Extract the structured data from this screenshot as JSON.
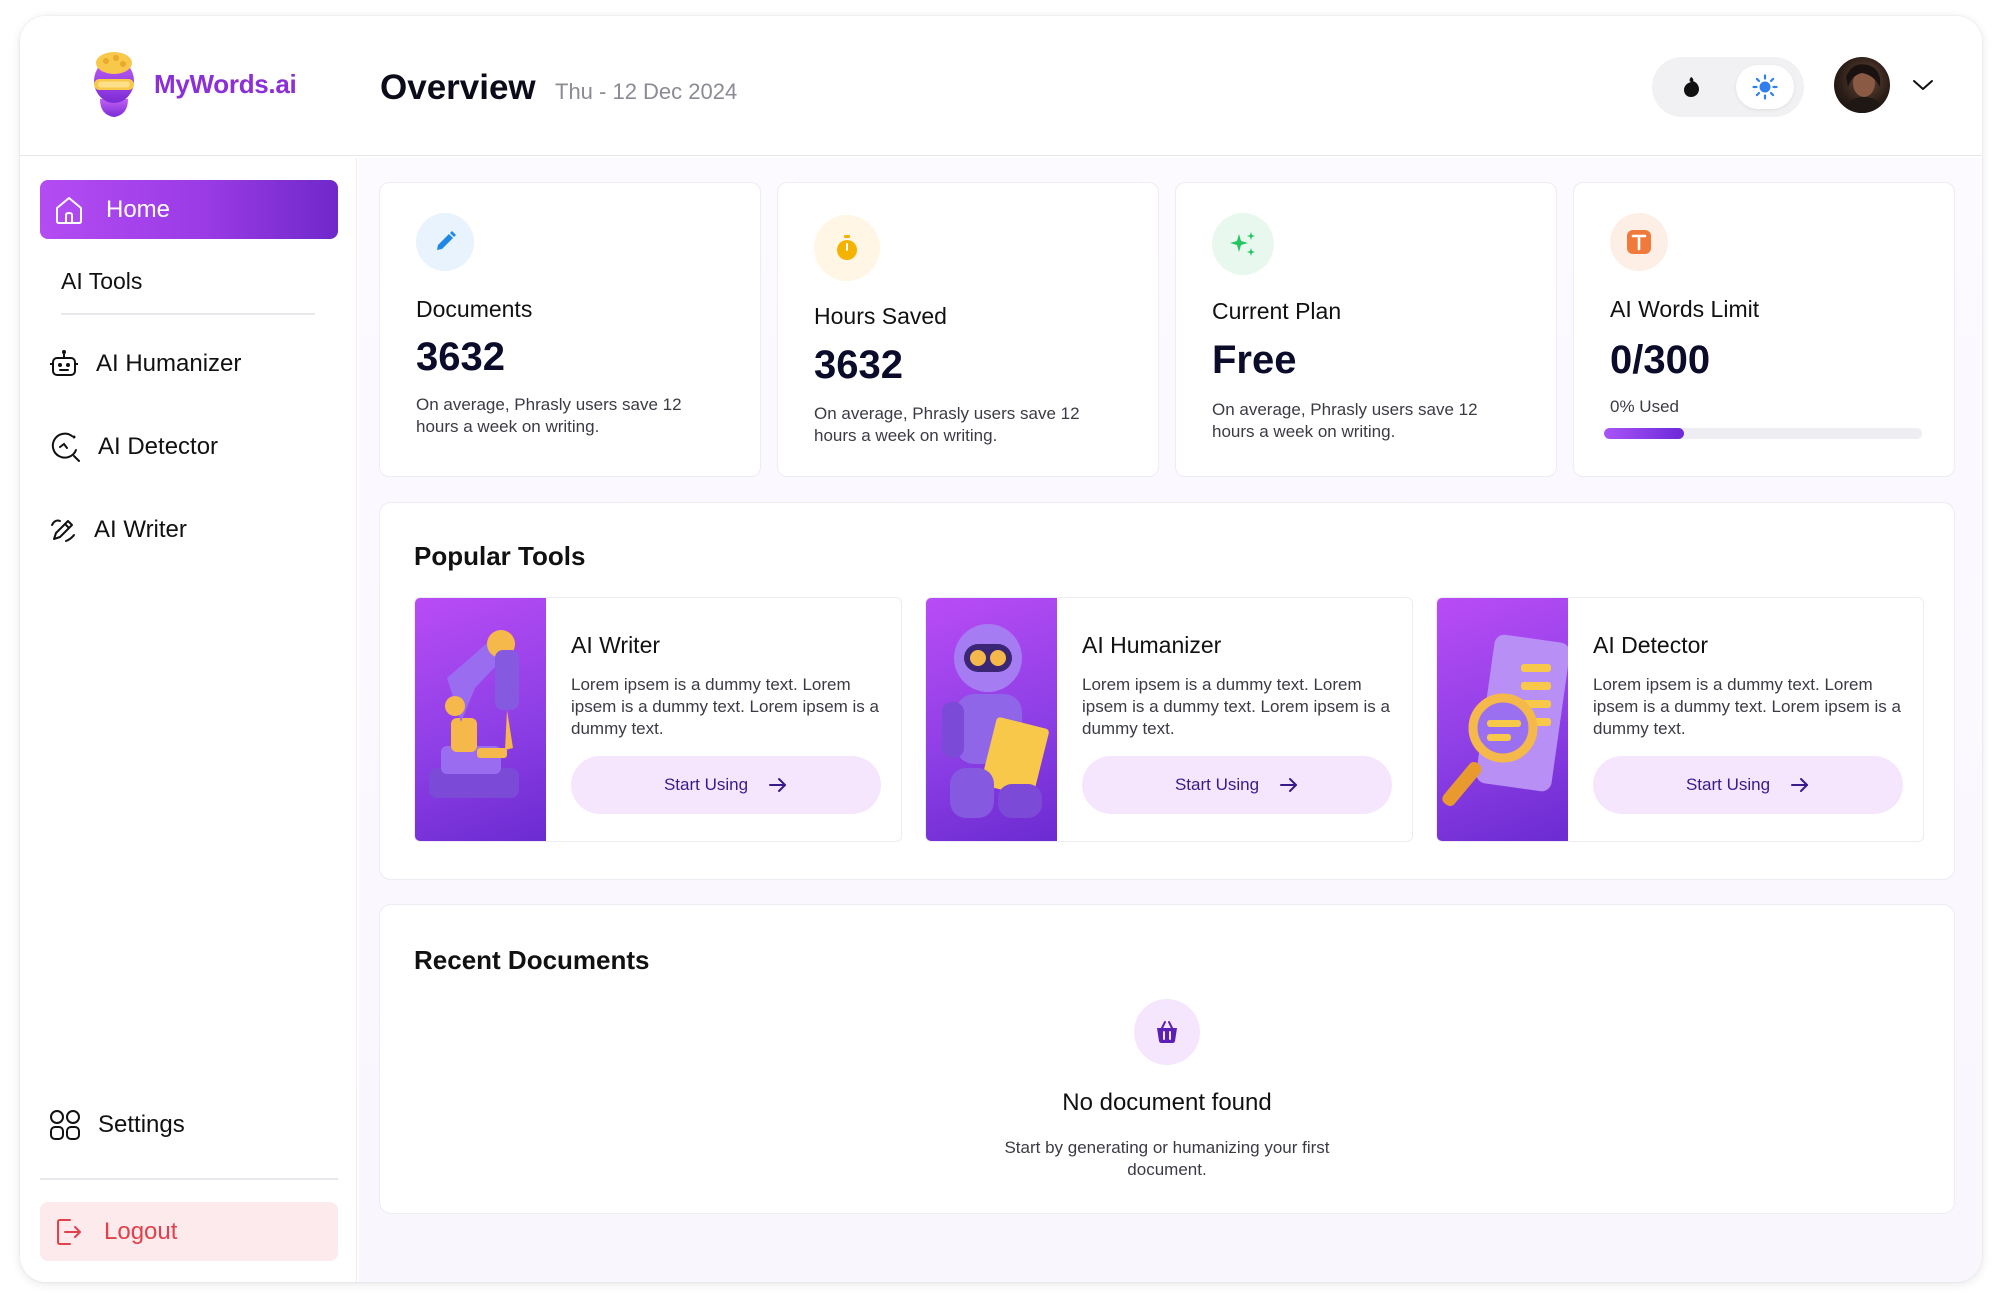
{
  "app": {
    "logo_text": "MyWords.ai",
    "brand_color": "#8b2fd6",
    "accent_gradient": [
      "#b44cf2",
      "#6f28c9"
    ]
  },
  "header": {
    "title": "Overview",
    "date": "Thu - 12 Dec 2024",
    "theme": {
      "options": [
        "dark-mode",
        "light-mode"
      ],
      "selected": "light-mode",
      "dark_icon": "moon-icon",
      "light_icon": "sun-icon"
    },
    "profile_menu_icon": "chevron-down-icon"
  },
  "sidebar": {
    "home": {
      "label": "Home",
      "icon": "home-icon",
      "active": true
    },
    "section_title": "AI Tools",
    "items": [
      {
        "label": "AI Humanizer",
        "icon": "robot-icon"
      },
      {
        "label": "AI Detector",
        "icon": "detector-icon"
      },
      {
        "label": "AI Writer",
        "icon": "pen-icon"
      }
    ],
    "settings": {
      "label": "Settings",
      "icon": "grid-icon"
    },
    "logout": {
      "label": "Logout",
      "icon": "logout-icon",
      "color": "#e2414b"
    }
  },
  "stats": [
    {
      "title": "Documents",
      "value": "3632",
      "desc": "On average, Phrasly users save 12 hours a week on writing.",
      "icon": "pencil-icon",
      "icon_bg": "#e8f3fd",
      "icon_color": "#1e88e5"
    },
    {
      "title": "Hours Saved",
      "value": "3632",
      "desc": "On average, Phrasly users save 12 hours a week on writing.",
      "icon": "stopwatch-icon",
      "icon_bg": "#fff6e5",
      "icon_color": "#f5b301"
    },
    {
      "title": "Current Plan",
      "value": "Free",
      "desc": "On average, Phrasly users save 12 hours a week on writing.",
      "icon": "sparkles-icon",
      "icon_bg": "#e8f8ee",
      "icon_color": "#22c55e"
    },
    {
      "title": "AI Words Limit",
      "value": "0/300",
      "usage_label": "0% Used",
      "usage_fraction": 0.25,
      "icon": "text-icon",
      "icon_bg": "#fdeee6",
      "icon_color": "#f07a3c"
    }
  ],
  "popular_tools": {
    "title": "Popular Tools",
    "tools": [
      {
        "name": "AI Writer",
        "desc": "Lorem ipsem is a dummy text. Lorem ipsem is a dummy text. Lorem ipsem is a dummy text.",
        "button": "Start Using",
        "art": "robot-arm-writing-illustration"
      },
      {
        "name": "AI Humanizer",
        "desc": "Lorem ipsem is a dummy text. Lorem ipsem is a dummy text. Lorem ipsem is a dummy text.",
        "button": "Start Using",
        "art": "robot-reading-illustration"
      },
      {
        "name": "AI Detector",
        "desc": "Lorem ipsem is a dummy text. Lorem ipsem is a dummy text. Lorem ipsem is a dummy text.",
        "button": "Start Using",
        "art": "magnifier-document-illustration"
      }
    ]
  },
  "recent_documents": {
    "title": "Recent Documents",
    "empty_icon": "basket-icon",
    "empty_title": "No document found",
    "empty_desc": "Start by generating or humanizing your first document."
  }
}
